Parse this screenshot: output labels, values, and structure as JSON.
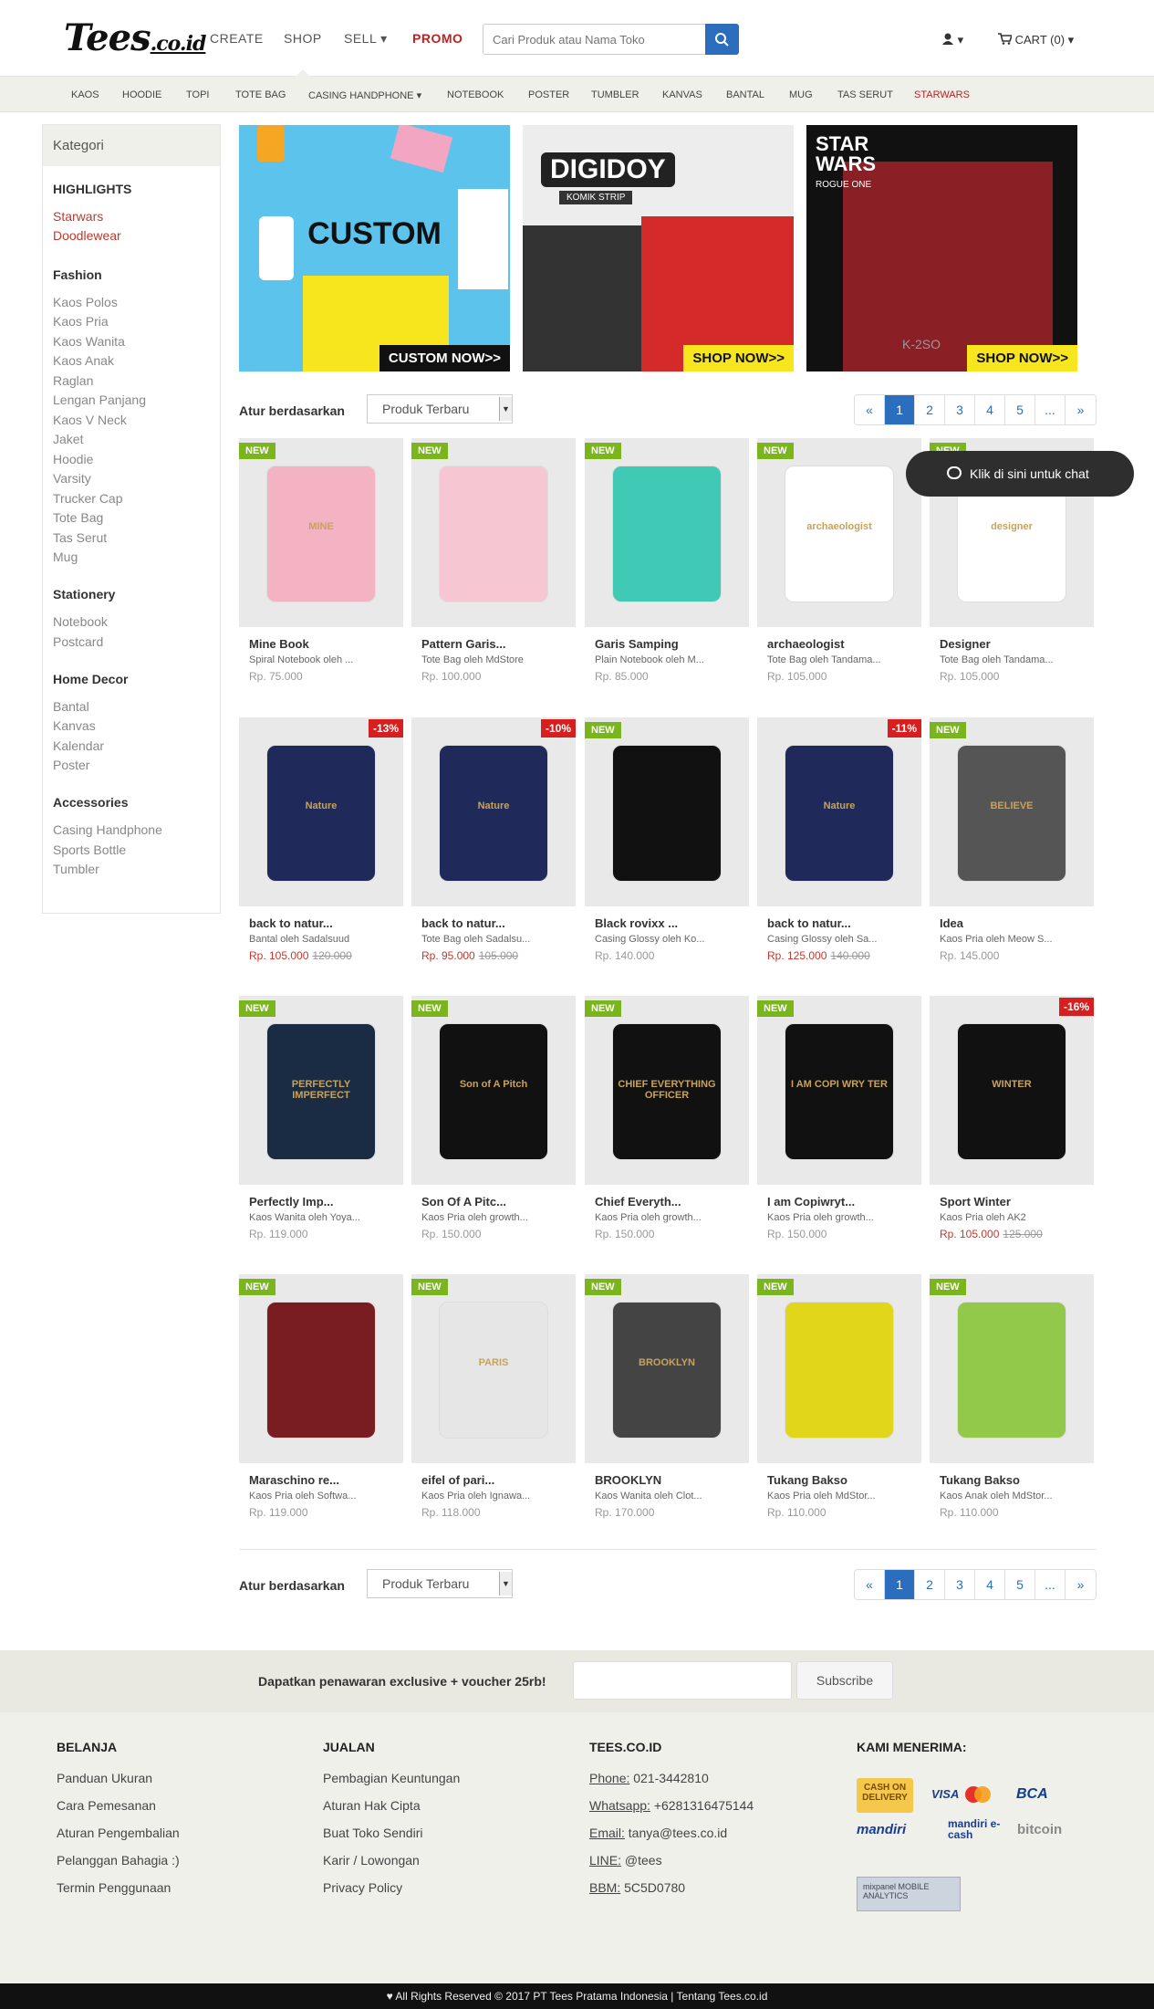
{
  "header": {
    "logo": "Tees",
    "logo_suffix": ".co.id",
    "nav": {
      "create": "CREATE",
      "shop": "SHOP",
      "sell": "SELL ▾",
      "promo": "PROMO"
    },
    "search_placeholder": "Cari Produk atau Nama Toko",
    "user_menu": "▾",
    "cart": "CART (0) ▾"
  },
  "categories": [
    "KAOS",
    "HOODIE",
    "TOPI",
    "TOTE BAG",
    "CASING HANDPHONE ▾",
    "NOTEBOOK",
    "POSTER",
    "TUMBLER",
    "KANVAS",
    "BANTAL",
    "MUG",
    "TAS SERUT",
    "STARWARS"
  ],
  "sidebar": {
    "title": "Kategori",
    "groups": [
      {
        "name": "HIGHLIGHTS",
        "items": [
          "Starwars",
          "Doodlewear"
        ]
      },
      {
        "name": "Fashion",
        "items": [
          "Kaos Polos",
          "Kaos Pria",
          "Kaos Wanita",
          "Kaos Anak",
          "Raglan",
          "Lengan Panjang",
          "Kaos V Neck",
          "Jaket",
          "Hoodie",
          "Varsity",
          "Trucker Cap",
          "Tote Bag",
          "Tas Serut",
          "Mug"
        ]
      },
      {
        "name": "Stationery",
        "items": [
          "Notebook",
          "Postcard"
        ]
      },
      {
        "name": "Home Decor",
        "items": [
          "Bantal",
          "Kanvas",
          "Kalendar",
          "Poster"
        ]
      },
      {
        "name": "Accessories",
        "items": [
          "Casing Handphone",
          "Sports Bottle",
          "Tumbler"
        ]
      }
    ]
  },
  "banners": {
    "custom_text": "CUSTOM",
    "custom_cta": "CUSTOM NOW>>",
    "digidoy_text": "DIGIDOY",
    "digidoy_sub": "KOMIK STRIP",
    "digidoy_cta": "SHOP NOW>>",
    "starwars_text": "STAR WARS",
    "starwars_sub": "ROGUE ONE",
    "starwars_code": "K-2SO",
    "starwars_cta": "SHOP NOW>>"
  },
  "sort": {
    "label": "Atur berdasarkan",
    "selected": "Produk Terbaru"
  },
  "pagination": [
    "«",
    "1",
    "2",
    "3",
    "4",
    "5",
    "...",
    "»"
  ],
  "chat": {
    "label": "Klik di sini untuk chat"
  },
  "products": [
    {
      "title": "Mine Book",
      "sub": "Spiral Notebook oleh ...",
      "price": "Rp. 75.000",
      "old": "",
      "badge": "NEW",
      "discount": "",
      "color": "#f4b3c2",
      "art": "MINE"
    },
    {
      "title": "Pattern Garis...",
      "sub": "Tote Bag oleh MdStore",
      "price": "Rp. 100.000",
      "old": "",
      "badge": "NEW",
      "discount": "",
      "color": "#f7c6d3",
      "art": ""
    },
    {
      "title": "Garis Samping",
      "sub": "Plain Notebook oleh M...",
      "price": "Rp. 85.000",
      "old": "",
      "badge": "NEW",
      "discount": "",
      "color": "#40c9b4",
      "art": ""
    },
    {
      "title": "archaeologist",
      "sub": "Tote Bag oleh Tandama...",
      "price": "Rp. 105.000",
      "old": "",
      "badge": "NEW",
      "discount": "",
      "color": "#ffffff",
      "art": "archaeologist"
    },
    {
      "title": "Designer",
      "sub": "Tote Bag oleh Tandama...",
      "price": "Rp. 105.000",
      "old": "",
      "badge": "NEW",
      "discount": "",
      "color": "#ffffff",
      "art": "designer"
    },
    {
      "title": "back to natur...",
      "sub": "Bantal oleh Sadalsuud",
      "price": "Rp. 105.000",
      "old": "120.000",
      "badge": "",
      "discount": "-13%",
      "color": "#1f2a5a",
      "art": "Nature"
    },
    {
      "title": "back to natur...",
      "sub": "Tote Bag oleh Sadalsu...",
      "price": "Rp. 95.000",
      "old": "105.000",
      "badge": "",
      "discount": "-10%",
      "color": "#1f2a5a",
      "art": "Nature"
    },
    {
      "title": "Black rovixx ...",
      "sub": "Casing Glossy oleh Ko...",
      "price": "Rp. 140.000",
      "old": "",
      "badge": "NEW",
      "discount": "",
      "color": "#111111",
      "art": ""
    },
    {
      "title": "back to natur...",
      "sub": "Casing Glossy oleh Sa...",
      "price": "Rp. 125.000",
      "old": "140.000",
      "badge": "",
      "discount": "-11%",
      "color": "#1f2a5a",
      "art": "Nature"
    },
    {
      "title": "Idea",
      "sub": "Kaos Pria oleh Meow S...",
      "price": "Rp. 145.000",
      "old": "",
      "badge": "NEW",
      "discount": "",
      "color": "#555555",
      "art": "BELIEVE"
    },
    {
      "title": "Perfectly Imp...",
      "sub": "Kaos Wanita oleh Yoya...",
      "price": "Rp. 119.000",
      "old": "",
      "badge": "NEW",
      "discount": "",
      "color": "#1a2c44",
      "art": "PERFECTLY IMPERFECT"
    },
    {
      "title": "Son Of A Pitc...",
      "sub": "Kaos Pria oleh growth...",
      "price": "Rp. 150.000",
      "old": "",
      "badge": "NEW",
      "discount": "",
      "color": "#111111",
      "art": "Son of A Pitch"
    },
    {
      "title": "Chief Everyth...",
      "sub": "Kaos Pria oleh growth...",
      "price": "Rp. 150.000",
      "old": "",
      "badge": "NEW",
      "discount": "",
      "color": "#111111",
      "art": "CHIEF EVERYTHING OFFICER"
    },
    {
      "title": "I am Copiwryt...",
      "sub": "Kaos Pria oleh growth...",
      "price": "Rp. 150.000",
      "old": "",
      "badge": "NEW",
      "discount": "",
      "color": "#111111",
      "art": "I AM COPI WRY TER"
    },
    {
      "title": "Sport Winter",
      "sub": "Kaos Pria oleh AK2",
      "price": "Rp. 105.000",
      "old": "125.000",
      "badge": "",
      "discount": "-16%",
      "color": "#111111",
      "art": "WINTER"
    },
    {
      "title": "Maraschino re...",
      "sub": "Kaos Pria oleh Softwa...",
      "price": "Rp. 119.000",
      "old": "",
      "badge": "NEW",
      "discount": "",
      "color": "#7a1d22",
      "art": ""
    },
    {
      "title": "eifel of pari...",
      "sub": "Kaos Pria oleh Ignawa...",
      "price": "Rp. 118.000",
      "old": "",
      "badge": "NEW",
      "discount": "",
      "color": "#e6e6e6",
      "art": "PARIS"
    },
    {
      "title": "BROOKLYN",
      "sub": "Kaos Wanita oleh Clot...",
      "price": "Rp. 170.000",
      "old": "",
      "badge": "NEW",
      "discount": "",
      "color": "#444444",
      "art": "BROOKLYN"
    },
    {
      "title": "Tukang Bakso",
      "sub": "Kaos Pria oleh MdStor...",
      "price": "Rp. 110.000",
      "old": "",
      "badge": "NEW",
      "discount": "",
      "color": "#e2d61b",
      "art": ""
    },
    {
      "title": "Tukang Bakso",
      "sub": "Kaos Anak oleh MdStor...",
      "price": "Rp. 110.000",
      "old": "",
      "badge": "NEW",
      "discount": "",
      "color": "#93c94a",
      "art": ""
    }
  ],
  "newsletter": {
    "text": "Dapatkan penawaran exclusive + voucher 25rb!",
    "button": "Subscribe"
  },
  "footer": {
    "belanja": {
      "title": "BELANJA",
      "links": [
        "Panduan Ukuran",
        "Cara Pemesanan",
        "Aturan Pengembalian",
        "Pelanggan Bahagia :)",
        "Termin Penggunaan"
      ]
    },
    "jualan": {
      "title": "JUALAN",
      "links": [
        "Pembagian Keuntungan",
        "Aturan Hak Cipta",
        "Buat Toko Sendiri",
        "Karir / Lowongan",
        "Privacy Policy"
      ]
    },
    "tees": {
      "title": "TEES.CO.ID",
      "rows": [
        {
          "label": "Phone:",
          "value": " 021-3442810"
        },
        {
          "label": "Whatsapp:",
          "value": " +6281316475144"
        },
        {
          "label": "Email:",
          "value": " tanya@tees.co.id"
        },
        {
          "label": "LINE:",
          "value": " @tees"
        },
        {
          "label": "BBM:",
          "value": " 5C5D0780"
        }
      ]
    },
    "payment": {
      "title": "KAMI MENERIMA:",
      "cod": "CASH ON DELIVERY",
      "visa": "VISA",
      "bca": "BCA",
      "mandiri": "mandiri",
      "mandiri_ecash": "mandiri e-cash",
      "bitcoin": "bitcoin",
      "mixpanel": "mixpanel MOBILE ANALYTICS"
    }
  },
  "copyright": "♥ All Rights Reserved © 2017 PT Tees Pratama Indonesia | Tentang Tees.co.id"
}
